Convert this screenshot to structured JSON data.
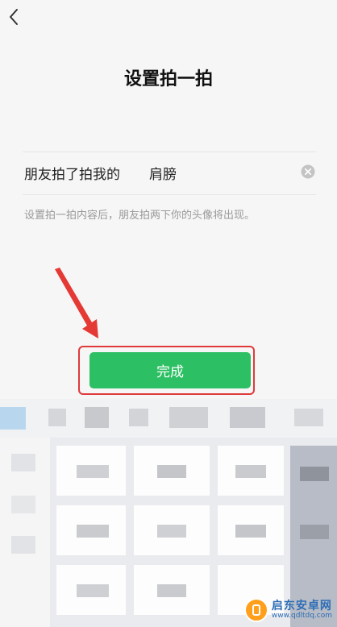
{
  "header": {
    "title": "设置拍一拍",
    "back_icon": "chevron-left-icon"
  },
  "form": {
    "prefix": "朋友拍了拍我的",
    "value": "肩膀",
    "clear_icon": "clear-circle-icon",
    "hint": "设置拍一拍内容后，朋友拍两下你的头像将出现。"
  },
  "actions": {
    "done_label": "完成"
  },
  "colors": {
    "primary": "#2dbf63",
    "highlight": "#e03a3a"
  },
  "watermark": {
    "name": "启东安卓网",
    "url": "www.qdltdq.com"
  }
}
